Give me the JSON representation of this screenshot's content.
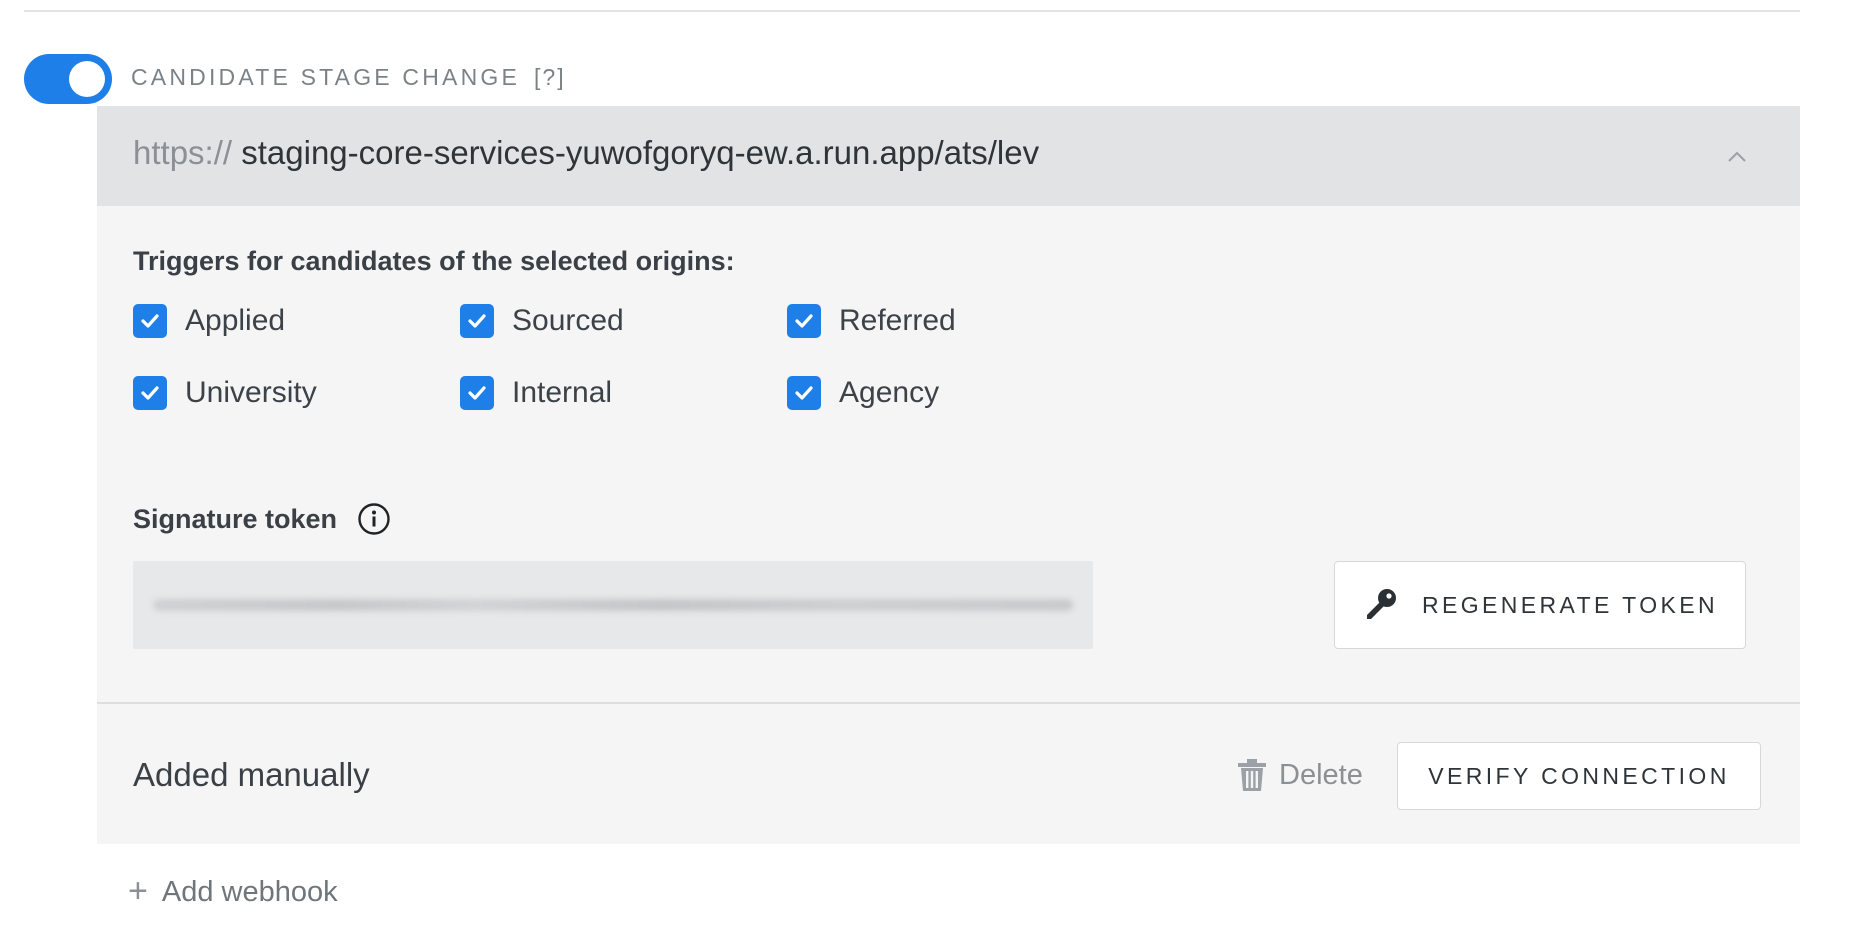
{
  "colors": {
    "accent": "#1f7fe8",
    "panel_bg": "#f5f5f5",
    "url_bar_bg": "#e2e3e5"
  },
  "section": {
    "title": "CANDIDATE STAGE CHANGE",
    "help": "[?]",
    "toggle_on": true
  },
  "webhook": {
    "url_scheme": "https://",
    "url_rest": "staging-core-services-yuwofgoryq-ew.a.run.app/ats/lev",
    "expanded_icon": "chevron-up-icon",
    "triggers_label": "Triggers for candidates of the selected origins:",
    "origins": [
      {
        "label": "Applied",
        "checked": true
      },
      {
        "label": "Sourced",
        "checked": true
      },
      {
        "label": "Referred",
        "checked": true
      },
      {
        "label": "University",
        "checked": true
      },
      {
        "label": "Internal",
        "checked": true
      },
      {
        "label": "Agency",
        "checked": true
      }
    ],
    "signature_label": "Signature token",
    "regenerate_label": "REGENERATE TOKEN",
    "added_label": "Added manually",
    "delete_label": "Delete",
    "verify_label": "VERIFY CONNECTION"
  },
  "add_webhook": {
    "icon": "plus-icon",
    "plus_glyph": "+",
    "label": "Add webhook"
  }
}
